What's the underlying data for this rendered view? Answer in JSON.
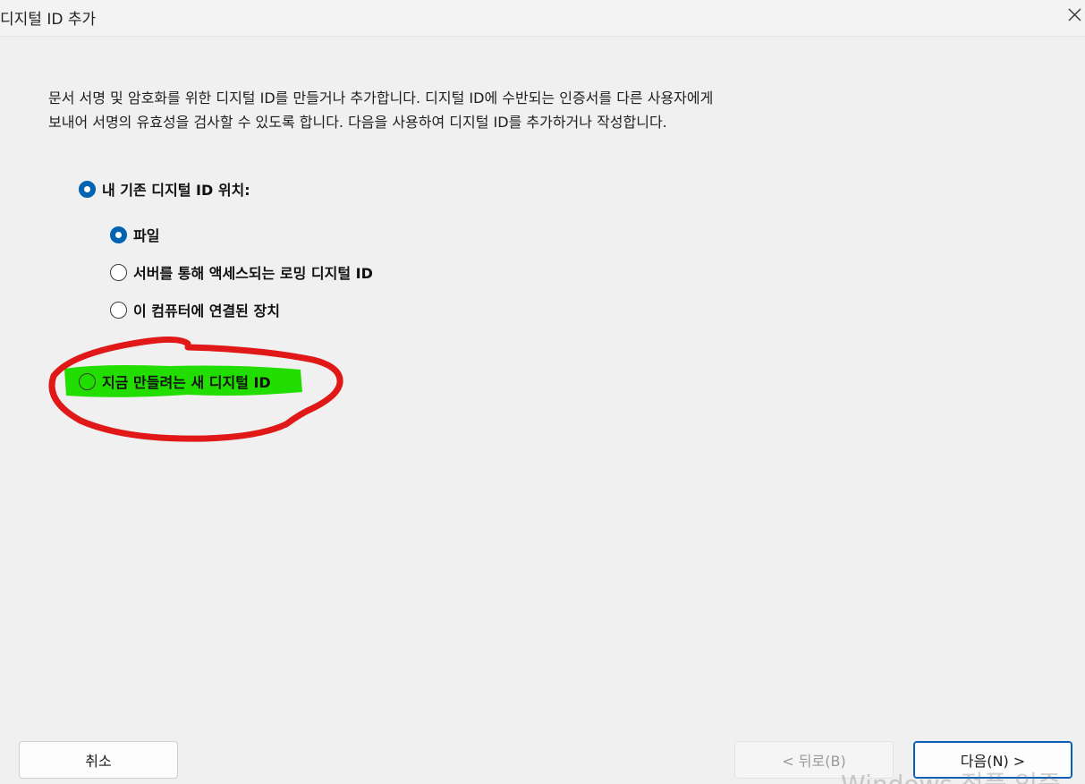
{
  "window": {
    "title": "디지털 ID 추가",
    "close_glyph": "✕"
  },
  "description": "문서 서명 및 암호화를 위한 디지털 ID를 만들거나 추가합니다. 디지털 ID에 수반되는 인증서를 다른 사용자에게 보내어 서명의 유효성을 검사할 수 있도록 합니다. 다음을 사용하여 디지털 ID를 추가하거나 작성합니다.",
  "options": {
    "existing": {
      "label": "내 기존 디지털 ID 위치:",
      "selected": true
    },
    "file": {
      "label": "파일",
      "selected": true
    },
    "roaming": {
      "label": "서버를 통해 액세스되는 로밍 디지털 ID",
      "selected": false
    },
    "device": {
      "label": "이 컴퓨터에 연결된 장치",
      "selected": false
    },
    "new_id": {
      "label": "지금 만들려는 새 디지털 ID",
      "selected": false
    }
  },
  "buttons": {
    "cancel": "취소",
    "back": "< 뒤로(B)",
    "next": "다음(N) >"
  },
  "watermark": "Windows 정품 인증",
  "colors": {
    "accent": "#0063b1",
    "highlight": "#22dd00",
    "annotation": "#e01818"
  }
}
